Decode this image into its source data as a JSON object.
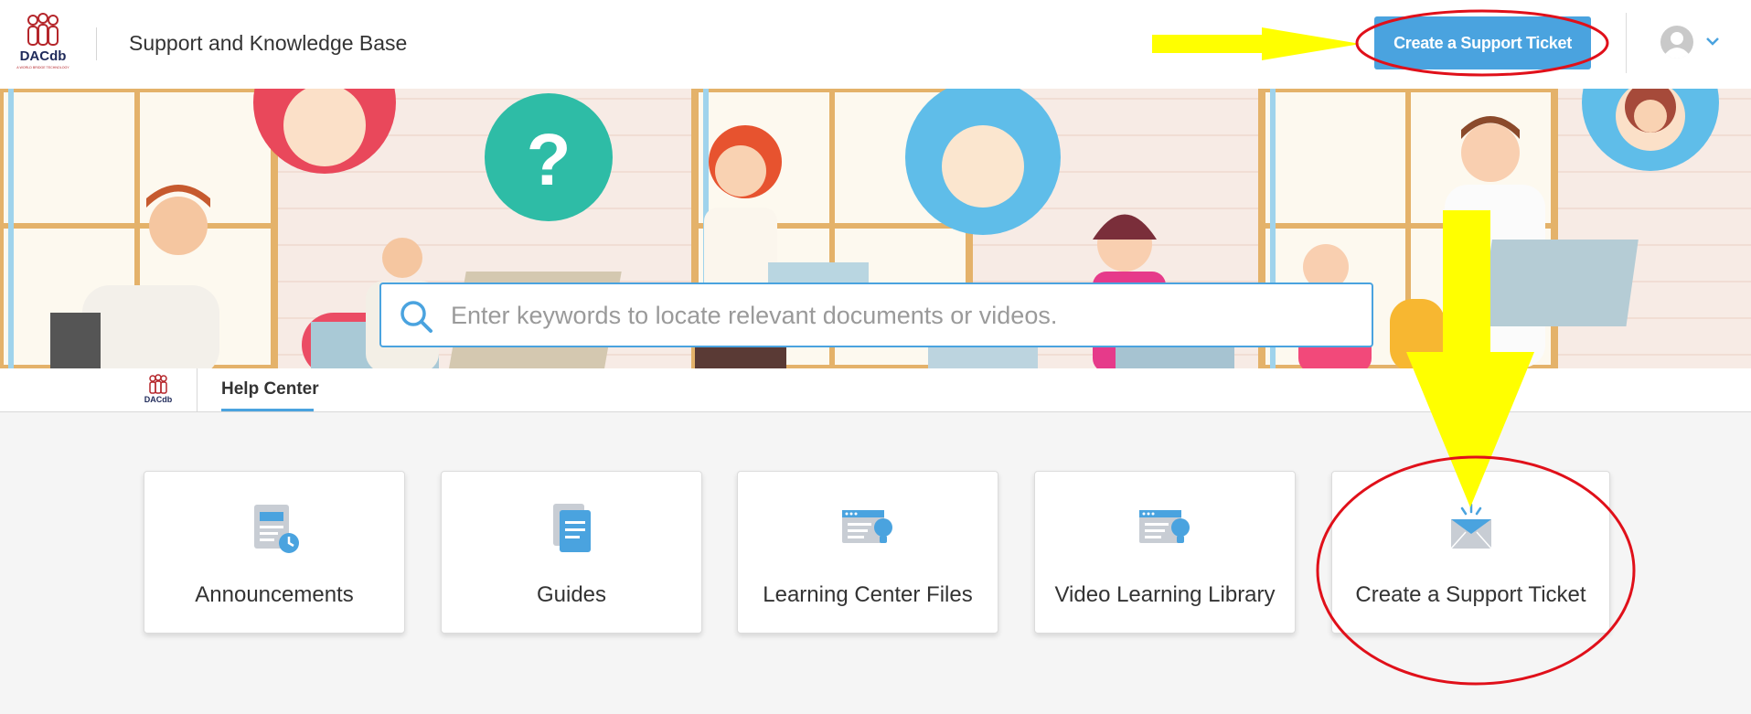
{
  "header": {
    "logo_text": "DACdb",
    "logo_tagline": "A WORLD BRIDGE TECHNOLOGY",
    "title": "Support and Knowledge Base",
    "cta_label": "Create a Support Ticket"
  },
  "hero": {
    "search_placeholder": "Enter keywords to locate relevant documents or videos."
  },
  "tabs": [
    {
      "label": "Help Center",
      "active": true
    }
  ],
  "cards": [
    {
      "label": "Announcements",
      "icon": "announcement-icon"
    },
    {
      "label": "Guides",
      "icon": "guide-document-icon"
    },
    {
      "label": "Learning Center Files",
      "icon": "learning-files-icon"
    },
    {
      "label": "Video Learning Library",
      "icon": "video-library-icon"
    },
    {
      "label": "Create a Support Ticket",
      "icon": "envelope-icon"
    }
  ],
  "colors": {
    "accent": "#4aa3df",
    "annotation_arrow": "#ffff00",
    "annotation_ellipse": "#e0101a",
    "brand_red": "#b5262b",
    "brand_navy": "#1f2a5a"
  }
}
